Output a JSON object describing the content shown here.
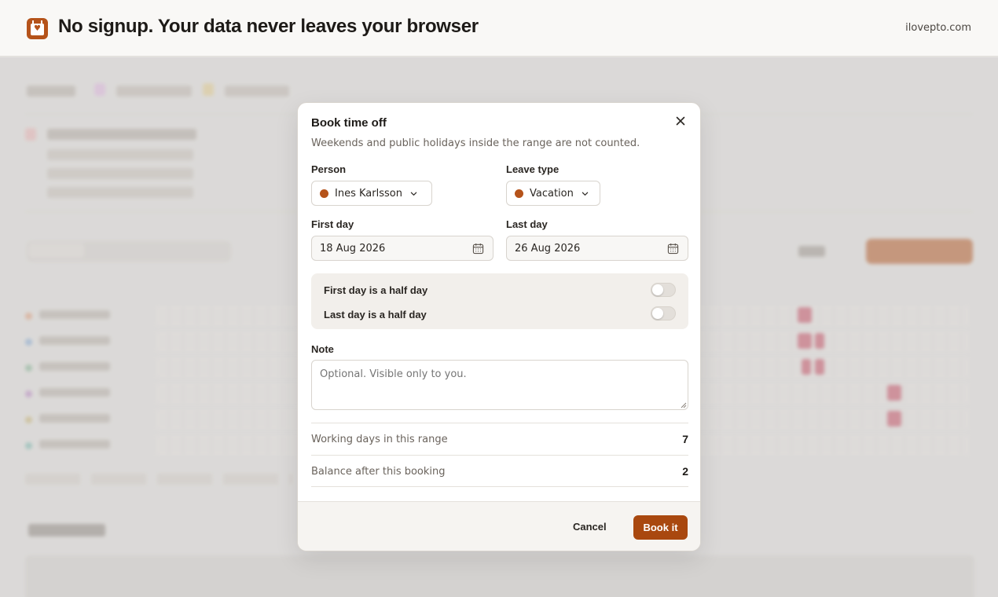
{
  "header": {
    "title": "No signup. Your data never leaves your browser",
    "site": "ilovepto.com",
    "logo_icon": "calendar-heart-icon"
  },
  "colors": {
    "accent": "#a9480f",
    "vacation": "#b5531a",
    "person": "#b5531a"
  },
  "modal": {
    "title": "Book time off",
    "subtitle": "Weekends and public holidays inside the range are not counted.",
    "close_icon": "close-icon",
    "person_label": "Person",
    "person_value": "Ines Karlsson",
    "leave_type_label": "Leave type",
    "leave_type_value": "Vacation",
    "first_day_label": "First day",
    "first_day_value": "18 Aug 2026",
    "last_day_label": "Last day",
    "last_day_value": "26 Aug 2026",
    "first_half_label": "First day is a half day",
    "last_half_label": "Last day is a half day",
    "first_half_on": false,
    "last_half_on": false,
    "note_label": "Note",
    "note_placeholder": "Optional. Visible only to you.",
    "working_days_label": "Working days in this range",
    "working_days_value": "7",
    "balance_label": "Balance after this booking",
    "balance_value": "2",
    "cancel_label": "Cancel",
    "book_label": "Book it"
  }
}
